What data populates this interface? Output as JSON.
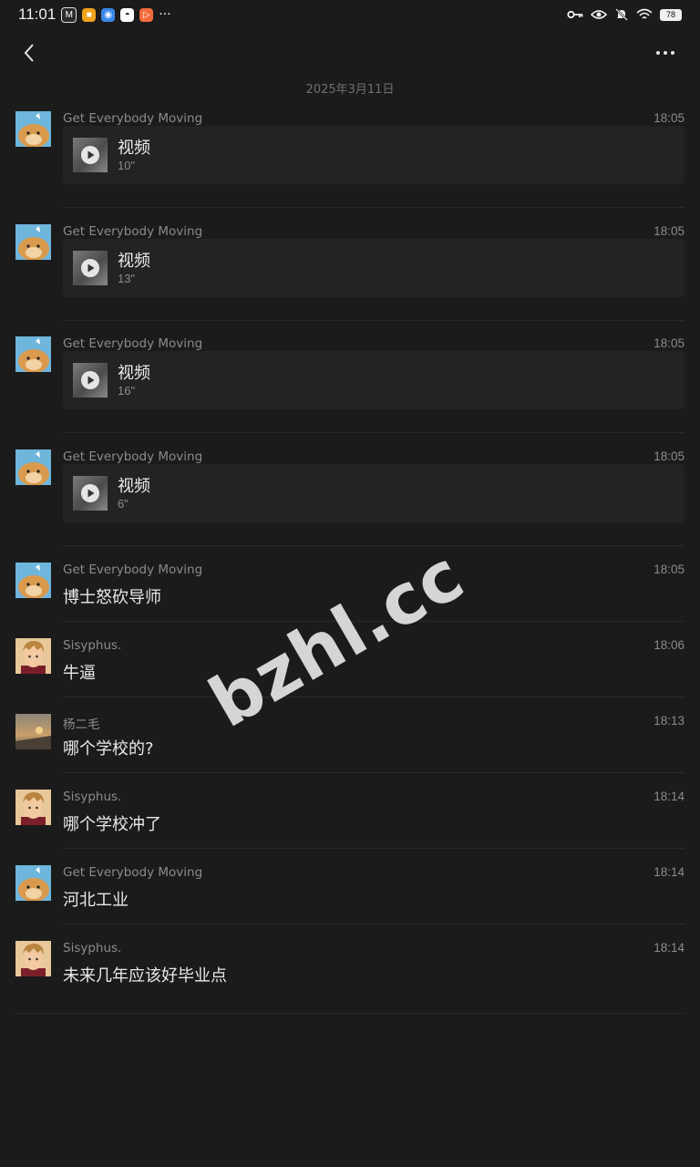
{
  "status_bar": {
    "time": "11:01",
    "notifications": [
      {
        "icon": "gmail-icon",
        "glyph": "M",
        "color": "#2b2b2b"
      },
      {
        "icon": "app-orange-icon",
        "glyph": "■",
        "color": "#f2a21b"
      },
      {
        "icon": "app-blue-icon",
        "glyph": "◉",
        "color": "#3a86e8"
      },
      {
        "icon": "penguin-icon",
        "glyph": "◓",
        "color": "#ffffff"
      },
      {
        "icon": "app-red-icon",
        "glyph": "▷",
        "color": "#f26a3c"
      }
    ],
    "more": "···",
    "battery": "78"
  },
  "conversation": {
    "date_separator": "2025年3月11日"
  },
  "messages": [
    {
      "sender": "Get Everybody Moving",
      "time": "18:05",
      "type": "video",
      "video_label": "视频",
      "duration": "10\""
    },
    {
      "sender": "Get Everybody Moving",
      "time": "18:05",
      "type": "video",
      "video_label": "视频",
      "duration": "13\""
    },
    {
      "sender": "Get Everybody Moving",
      "time": "18:05",
      "type": "video",
      "video_label": "视频",
      "duration": "16\""
    },
    {
      "sender": "Get Everybody Moving",
      "time": "18:05",
      "type": "video",
      "video_label": "视频",
      "duration": "6\""
    },
    {
      "sender": "Get Everybody Moving",
      "time": "18:05",
      "type": "text",
      "text": "博士怒砍导师"
    },
    {
      "sender": "Sisyphus.",
      "time": "18:06",
      "type": "text",
      "text": "牛逼"
    },
    {
      "sender": "杨二毛",
      "time": "18:13",
      "type": "text",
      "text": "哪个学校的?"
    },
    {
      "sender": "Sisyphus.",
      "time": "18:14",
      "type": "text",
      "text": "哪个学校冲了"
    },
    {
      "sender": "Get Everybody Moving",
      "time": "18:14",
      "type": "text",
      "text": "河北工业"
    },
    {
      "sender": "Sisyphus.",
      "time": "18:14",
      "type": "text",
      "text": "未来几年应该好毕业点"
    }
  ],
  "watermark": "bzhl.cc"
}
